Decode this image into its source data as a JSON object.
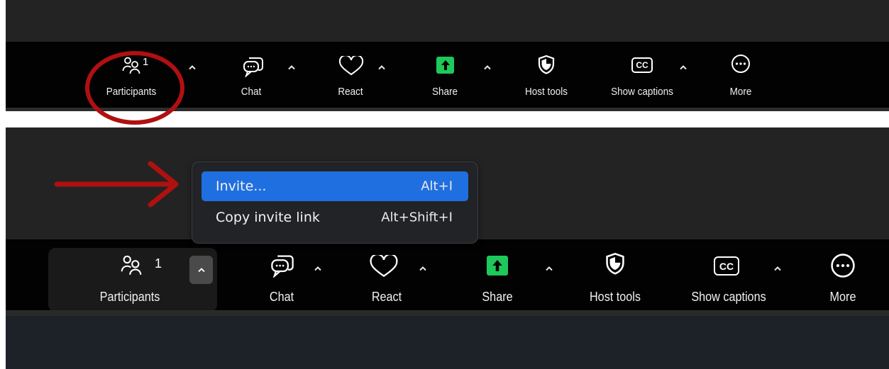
{
  "toolbar": {
    "participants_label": "Participants",
    "participants_count": "1",
    "chat_label": "Chat",
    "react_label": "React",
    "share_label": "Share",
    "host_tools_label": "Host tools",
    "show_captions_label": "Show captions",
    "captions_icon_text": "CC",
    "more_label": "More"
  },
  "menu": {
    "items": [
      {
        "label": "Invite...",
        "shortcut": "Alt+I"
      },
      {
        "label": "Copy invite link",
        "shortcut": "Alt+Shift+I"
      }
    ]
  },
  "colors": {
    "share_green": "#1ec85a",
    "menu_highlight": "#1f6fe0",
    "annotation_red": "#b01010"
  },
  "icons": [
    "participants-icon",
    "chat-icon",
    "react-heart-icon",
    "share-arrow-icon",
    "host-tools-shield-icon",
    "closed-captions-icon",
    "more-ellipsis-icon",
    "chevron-up-icon"
  ]
}
